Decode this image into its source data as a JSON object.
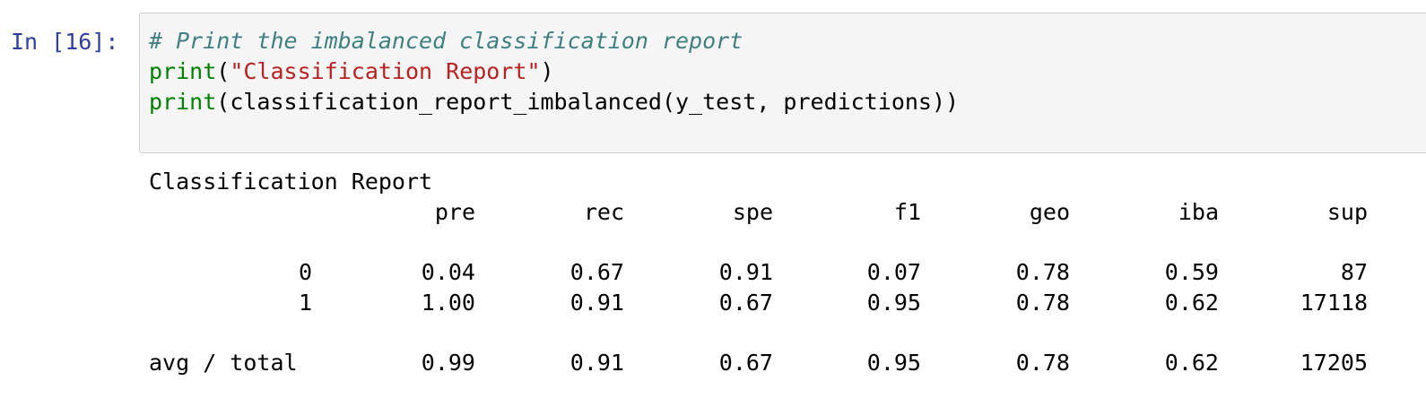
{
  "cell": {
    "prompt": "In [16]:",
    "code": {
      "line1_comment": "# Print the imbalanced classification report",
      "line2_func": "print",
      "line2_open": "(",
      "line2_string": "\"Classification Report\"",
      "line2_close": ")",
      "line3_func": "print",
      "line3_rest": "(classification_report_imbalanced(y_test, predictions))"
    }
  },
  "output": {
    "title": "Classification Report",
    "columns": [
      "pre",
      "rec",
      "spe",
      "f1",
      "geo",
      "iba",
      "sup"
    ],
    "rows": [
      {
        "label": "0",
        "values": [
          "0.04",
          "0.67",
          "0.91",
          "0.07",
          "0.78",
          "0.59",
          "87"
        ]
      },
      {
        "label": "1",
        "values": [
          "1.00",
          "0.91",
          "0.67",
          "0.95",
          "0.78",
          "0.62",
          "17118"
        ]
      }
    ],
    "total": {
      "label": "avg / total",
      "values": [
        "0.99",
        "0.91",
        "0.67",
        "0.95",
        "0.78",
        "0.62",
        "17205"
      ]
    }
  },
  "colors": {
    "prompt": "#303f9f",
    "comment": "#408080",
    "builtin": "#008000",
    "string": "#ba2121",
    "input_bg": "#f5f5f5",
    "input_border": "#cfcfcf"
  }
}
